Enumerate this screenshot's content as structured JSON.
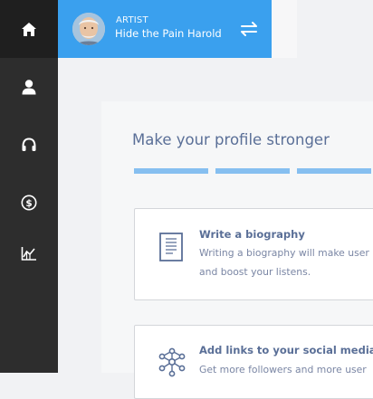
{
  "sidebar": {
    "items": [
      {
        "icon": "home-icon",
        "active": true
      },
      {
        "icon": "user-icon",
        "active": false
      },
      {
        "icon": "headphones-icon",
        "active": false
      },
      {
        "icon": "dollar-icon",
        "active": false
      },
      {
        "icon": "chart-icon",
        "active": false
      }
    ]
  },
  "artist": {
    "role": "ARTIST",
    "name": "Hide the Pain Harold"
  },
  "profile": {
    "title": "Make your profile stronger",
    "progress_segments": 3
  },
  "cards": [
    {
      "icon": "document-icon",
      "title": "Write a biography",
      "description_line1": "Writing a biography will make user",
      "description_line2": "and boost your listens."
    },
    {
      "icon": "network-icon",
      "title": "Add links to your social media",
      "description_line1": "Get more followers and more user"
    }
  ],
  "colors": {
    "sidebar_bg": "#2d2d2d",
    "accent": "#3aa0ee",
    "title_text": "#5a6f97",
    "progress": "#86bff0"
  }
}
